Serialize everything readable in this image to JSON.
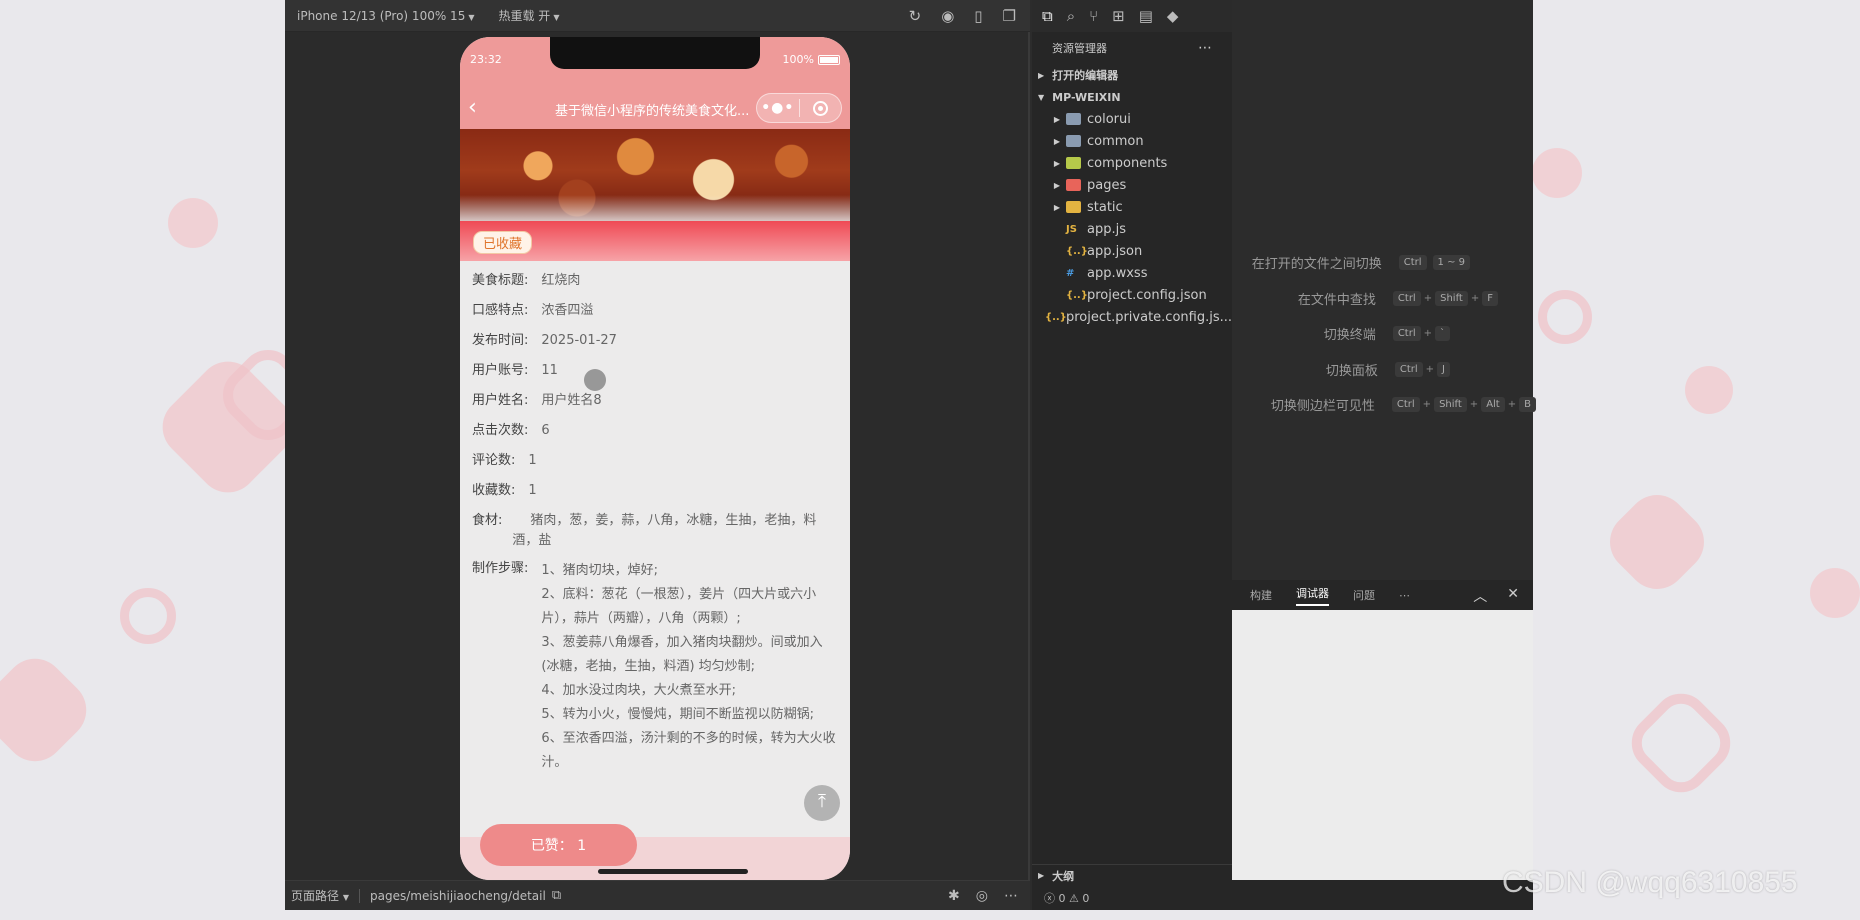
{
  "simulator": {
    "device_label": "iPhone 12/13 (Pro) 100% 15",
    "hot_reload_label": "热重载 开"
  },
  "phone": {
    "time": "23:32",
    "battery": "100%",
    "nav_title": "基于微信小程序的传统美食文化...",
    "collected_badge": "已收藏",
    "details": [
      {
        "label": "美食标题:",
        "value": "红烧肉"
      },
      {
        "label": "口感特点:",
        "value": "浓香四溢"
      },
      {
        "label": "发布时间:",
        "value": "2025-01-27"
      },
      {
        "label": "用户账号:",
        "value": "11"
      },
      {
        "label": "用户姓名:",
        "value": "用户姓名8"
      },
      {
        "label": "点击次数:",
        "value": "6"
      },
      {
        "label": "评论数:",
        "value": "1"
      },
      {
        "label": "收藏数:",
        "value": "1"
      }
    ],
    "ingredients_label": "食材:",
    "ingredients_value": "猪肉，葱，姜，蒜，八角，冰糖，生抽，老抽，料酒，盐",
    "steps_label": "制作步骤:",
    "steps": [
      "1、猪肉切块，焯好;",
      "2、底料：葱花（一根葱），姜片（四大片或六小片），蒜片（两瓣），八角（两颗）;",
      "3、葱姜蒜八角爆香，加入猪肉块翻炒。间或加入 (冰糖，老抽，生抽，料酒)  均匀炒制;",
      "4、加水没过肉块，大火煮至水开;",
      "5、转为小火，慢慢炖，期间不断监视以防糊锅;",
      "6、至浓香四溢，汤汁剩的不多的时候，转为大火收汁。"
    ],
    "like_button": "已赞： 1"
  },
  "footer": {
    "path_label": "页面路径",
    "path_value": "pages/meishijiaocheng/detail"
  },
  "explorer": {
    "title": "资源管理器",
    "open_editors": "打开的编辑器",
    "project": "MP-WEIXIN",
    "folders": [
      {
        "name": "colorui",
        "color": "#8a9bb0"
      },
      {
        "name": "common",
        "color": "#8a9bb0"
      },
      {
        "name": "components",
        "color": "#b6c94a"
      },
      {
        "name": "pages",
        "color": "#e8645a"
      },
      {
        "name": "static",
        "color": "#e3b341"
      }
    ],
    "files": [
      {
        "name": "app.js",
        "icon": "JS",
        "color": "#e3b341"
      },
      {
        "name": "app.json",
        "icon": "{..}",
        "color": "#e3b341"
      },
      {
        "name": "app.wxss",
        "icon": "#",
        "color": "#4a9be0"
      },
      {
        "name": "project.config.json",
        "icon": "{..}",
        "color": "#e3b341"
      },
      {
        "name": "project.private.config.js...",
        "icon": "{..}",
        "color": "#e3b341"
      }
    ],
    "outline": "大纲",
    "problems": "0 0"
  },
  "editor": {
    "shortcuts": [
      {
        "label": "在打开的文件之间切换",
        "keys": [
          "Ctrl",
          "1 ~ 9"
        ]
      },
      {
        "label": "在文件中查找",
        "keys": [
          "Ctrl",
          "+",
          "Shift",
          "+",
          "F"
        ]
      },
      {
        "label": "切换终端",
        "keys": [
          "Ctrl",
          "+",
          "`"
        ]
      },
      {
        "label": "切换面板",
        "keys": [
          "Ctrl",
          "+",
          "J"
        ]
      },
      {
        "label": "切换侧边栏可见性",
        "keys": [
          "Ctrl",
          "+",
          "Shift",
          "+",
          "Alt",
          "+",
          "B"
        ]
      }
    ]
  },
  "debug": {
    "tabs": [
      "构建",
      "调试器",
      "问题"
    ],
    "active_tab": "调试器"
  },
  "watermark": "CSDN @wqq6310855"
}
